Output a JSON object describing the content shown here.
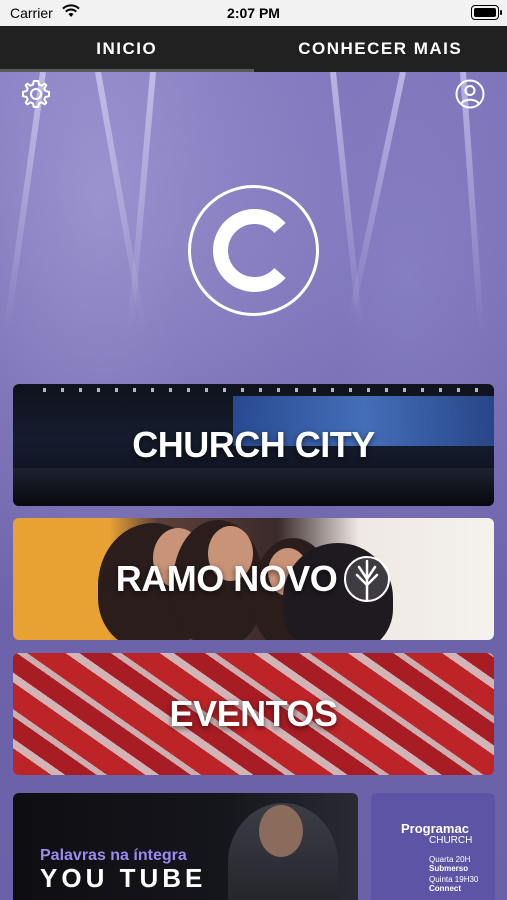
{
  "status_bar": {
    "carrier": "Carrier",
    "time": "2:07 PM"
  },
  "tabs": [
    {
      "label": "INICIO",
      "active": true
    },
    {
      "label": "CONHECER MAIS",
      "active": false
    }
  ],
  "header": {
    "settings_icon": "gear-icon",
    "profile_icon": "user-circle-icon"
  },
  "logo": {
    "letter": "C"
  },
  "banners": {
    "church_city": "CHURCH CITY",
    "ramo_novo": "RAMO NOVO",
    "eventos": "EVENTOS",
    "youtube": {
      "tagline": "Palavras na íntegra",
      "title": "YOU TUBE"
    },
    "programacao": {
      "title": "Programac",
      "subtitle": "CHURCH",
      "lines": [
        "Quarta 20H",
        "Submerso",
        "Quinta 19H30",
        "Connect"
      ]
    }
  },
  "colors": {
    "accent": "#6e64aa",
    "tab_bg": "#212121"
  }
}
